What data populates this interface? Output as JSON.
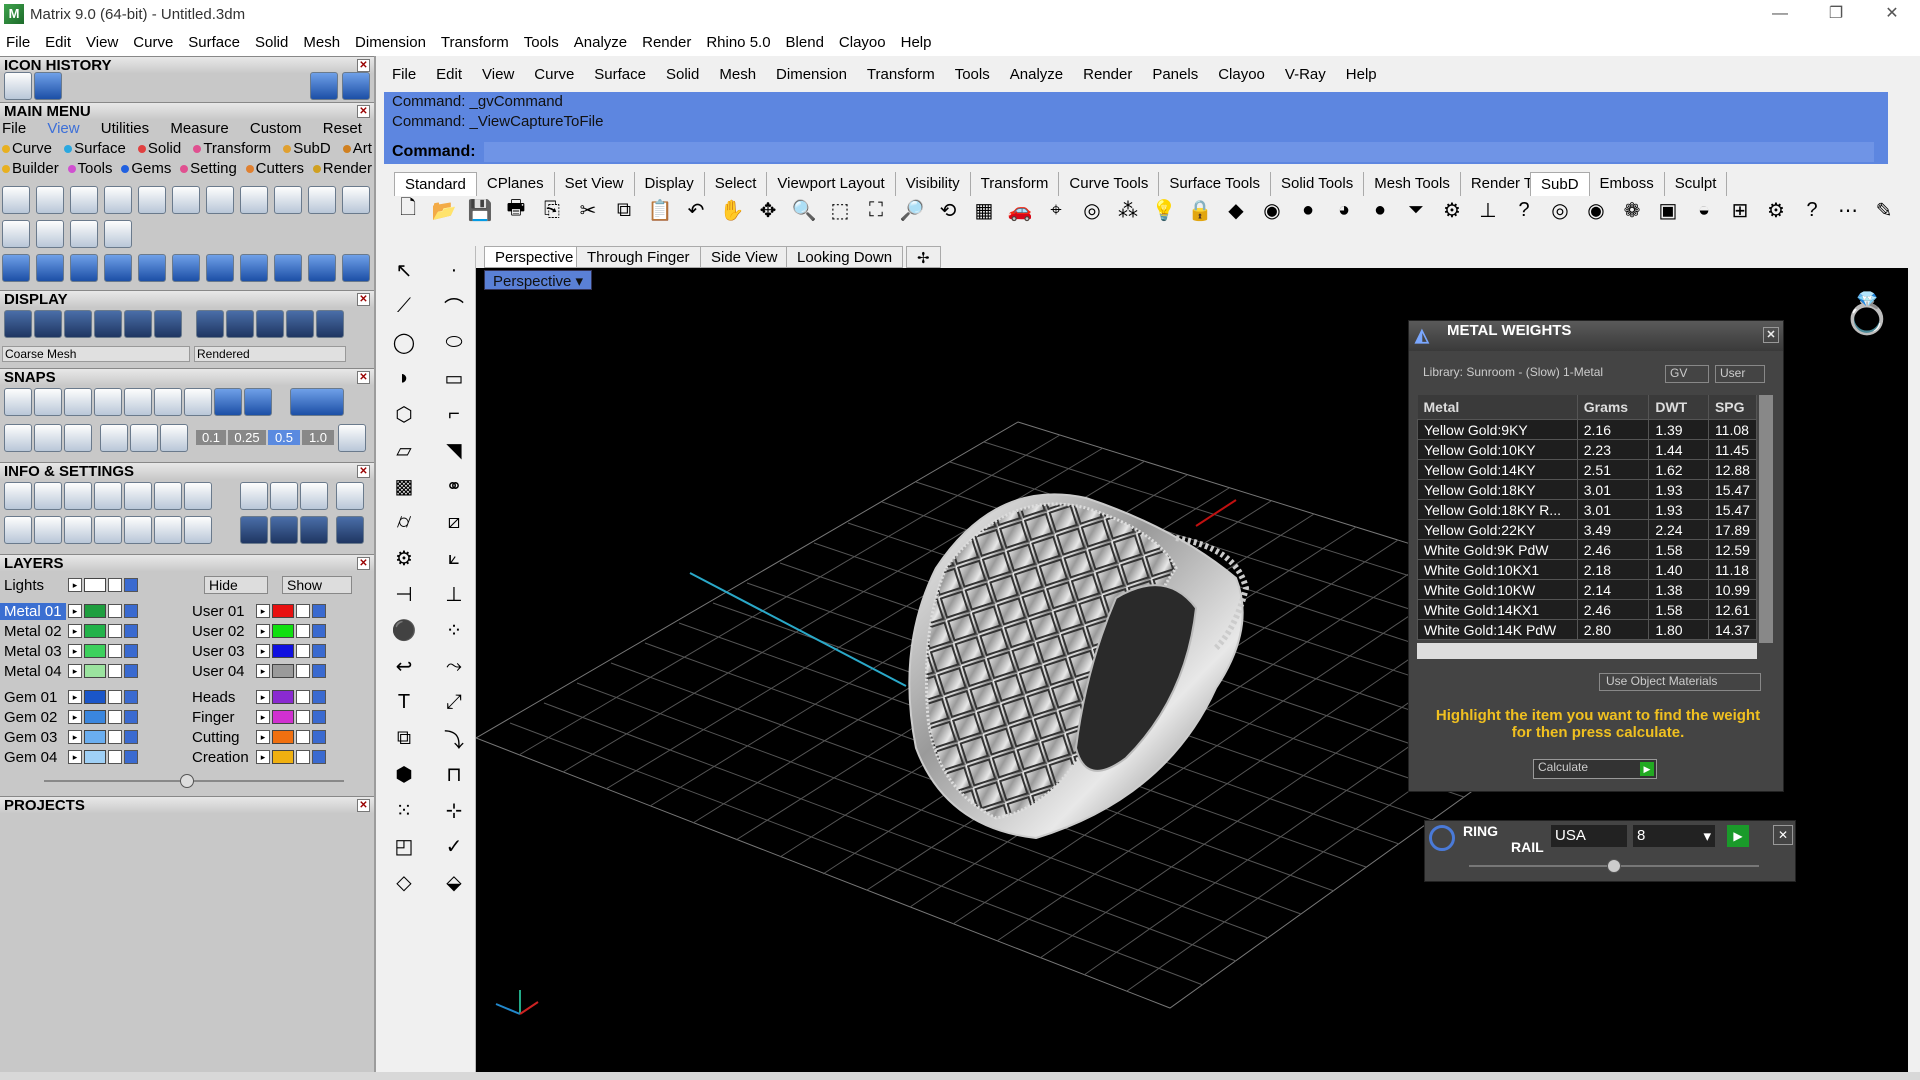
{
  "window": {
    "title": "Matrix 9.0 (64-bit) - Untitled.3dm",
    "controls": [
      "—",
      "❐",
      "✕"
    ]
  },
  "main_menu": [
    "File",
    "Edit",
    "View",
    "Curve",
    "Surface",
    "Solid",
    "Mesh",
    "Dimension",
    "Transform",
    "Tools",
    "Analyze",
    "Render",
    "Rhino 5.0",
    "Blend",
    "Clayoo",
    "Help"
  ],
  "left": {
    "icon_history": "ICON HISTORY",
    "main_menu_title": "MAIN MENU",
    "mm_tabs": [
      "File",
      "View",
      "Utilities",
      "Measure",
      "Custom",
      "Reset"
    ],
    "mm_row1": [
      "Curve",
      "Surface",
      "Solid",
      "Transform",
      "SubD",
      "Art"
    ],
    "mm_row2": [
      "Builder",
      "Tools",
      "Gems",
      "Setting",
      "Cutters",
      "Render"
    ],
    "display_title": "DISPLAY",
    "display_mesh": "Coarse Mesh",
    "display_mode": "Rendered",
    "snaps_title": "SNAPS",
    "snap_values": [
      "0.1",
      "0.25",
      "0.5",
      "1.0"
    ],
    "info_title": "INFO & SETTINGS",
    "layers_title": "LAYERS",
    "lights": "Lights",
    "hide": "Hide",
    "show": "Show",
    "layers_left": [
      {
        "name": "Metal 01",
        "color": "#1f9e3f"
      },
      {
        "name": "Metal 02",
        "color": "#22b24a"
      },
      {
        "name": "Metal 03",
        "color": "#3dd05d"
      },
      {
        "name": "Metal 04",
        "color": "#9be39f"
      },
      {
        "name": "Gem 01",
        "color": "#1a56c9"
      },
      {
        "name": "Gem 02",
        "color": "#3a86de"
      },
      {
        "name": "Gem 03",
        "color": "#6aaef0"
      },
      {
        "name": "Gem 04",
        "color": "#9fd0f6"
      }
    ],
    "layers_right": [
      {
        "name": "User 01",
        "color": "#e81010"
      },
      {
        "name": "User 02",
        "color": "#10e010"
      },
      {
        "name": "User 03",
        "color": "#1010e0"
      },
      {
        "name": "User 04",
        "color": "#9a9a9a"
      },
      {
        "name": "Heads",
        "color": "#8a2ad0"
      },
      {
        "name": "Finger",
        "color": "#d030d0"
      },
      {
        "name": "Cutting",
        "color": "#f07010"
      },
      {
        "name": "Creation",
        "color": "#f0b010"
      }
    ],
    "projects_title": "PROJECTS"
  },
  "rhino_menu": [
    "File",
    "Edit",
    "View",
    "Curve",
    "Surface",
    "Solid",
    "Mesh",
    "Dimension",
    "Transform",
    "Tools",
    "Analyze",
    "Render",
    "Panels",
    "Clayoo",
    "V-Ray",
    "Help"
  ],
  "command": {
    "line1": "Command: _gvCommand",
    "line2": "Command: _ViewCaptureToFile",
    "prompt": "Command:"
  },
  "toolbar_tabs": [
    "Standard",
    "CPlanes",
    "Set View",
    "Display",
    "Select",
    "Viewport Layout",
    "Visibility",
    "Transform",
    "Curve Tools",
    "Surface Tools",
    "Solid Tools",
    "Mesh Tools",
    "Render To"
  ],
  "toolbar_tabs_right": [
    "SubD",
    "Emboss",
    "Sculpt"
  ],
  "viewport_tabs": [
    "Perspective",
    "Through Finger",
    "Side View",
    "Looking Down"
  ],
  "viewport_label": "Perspective",
  "metal_weights": {
    "title": "METAL WEIGHTS",
    "library": "Library: Sunroom - (Slow) 1-Metal",
    "gv": "GV",
    "user": "User",
    "columns": [
      "Metal",
      "Grams",
      "DWT",
      "SPG"
    ],
    "rows": [
      [
        "Yellow Gold:9KY",
        "2.16",
        "1.39",
        "11.08"
      ],
      [
        "Yellow Gold:10KY",
        "2.23",
        "1.44",
        "11.45"
      ],
      [
        "Yellow Gold:14KY",
        "2.51",
        "1.62",
        "12.88"
      ],
      [
        "Yellow Gold:18KY",
        "3.01",
        "1.93",
        "15.47"
      ],
      [
        "Yellow Gold:18KY R...",
        "3.01",
        "1.93",
        "15.47"
      ],
      [
        "Yellow Gold:22KY",
        "3.49",
        "2.24",
        "17.89"
      ],
      [
        "White Gold:9K PdW",
        "2.46",
        "1.58",
        "12.59"
      ],
      [
        "White Gold:10KX1",
        "2.18",
        "1.40",
        "11.18"
      ],
      [
        "White Gold:10KW",
        "2.14",
        "1.38",
        "10.99"
      ],
      [
        "White Gold:14KX1",
        "2.46",
        "1.58",
        "12.61"
      ],
      [
        "White Gold:14K PdW",
        "2.80",
        "1.80",
        "14.37"
      ]
    ],
    "use_object": "Use Object Materials",
    "hint": "Highlight the item you want to find the weight for then press calculate.",
    "calculate": "Calculate"
  },
  "ring_rail": {
    "title1": "RING",
    "title2": "RAIL",
    "region": "USA",
    "size": "8"
  }
}
